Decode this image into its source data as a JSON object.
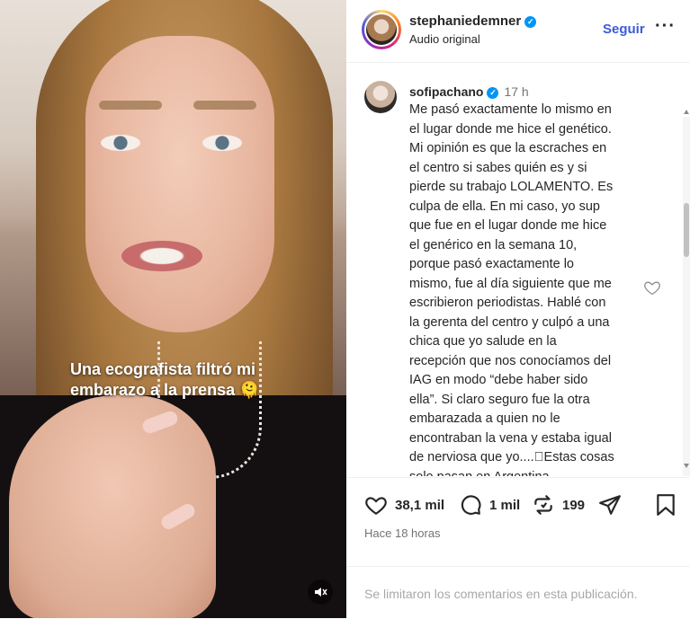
{
  "video": {
    "caption_line1": "Una ecografista filtró mi",
    "caption_line2": "embarazo a la prensa 🫠",
    "mute_icon": "speaker-muted-icon"
  },
  "header": {
    "username": "stephaniedemner",
    "subtitle": "Audio original",
    "follow_label": "Seguir",
    "more_label": "···"
  },
  "comment": {
    "username": "sofipachano",
    "time": "17 h",
    "text": "Me pasó exactamente lo mismo en\nel lugar donde me hice el genético.\nMi opinión es que la escraches en\nel centro si sabes quién es y si\npierde su trabajo LOLAMENTO. Es\nculpa de ella. En mi caso, yo sup\nque fue en el lugar donde me hice\nel genérico en la semana 10,\nporque pasó exactamente lo\nmismo, fue al día siguiente que me\nescribieron periodistas. Hablé con\nla gerenta del centro y culpó a una\nchica que yo salude en la\nrecepción que nos conocíamos del\nIAG en modo “debe haber sido\nella”. Si claro seguro fue la otra\nembarazada a quien no le\nencontraban la vena y estaba igual\nde nerviosa que yo....􏿽Estas cosas\nsolo pasan en Argentina"
  },
  "actions": {
    "likes": "38,1 mil",
    "comments": "1 mil",
    "reposts": "199"
  },
  "posted": "Hace 18 horas",
  "limited_notice": "Se limitaron los comentarios en esta publicación."
}
